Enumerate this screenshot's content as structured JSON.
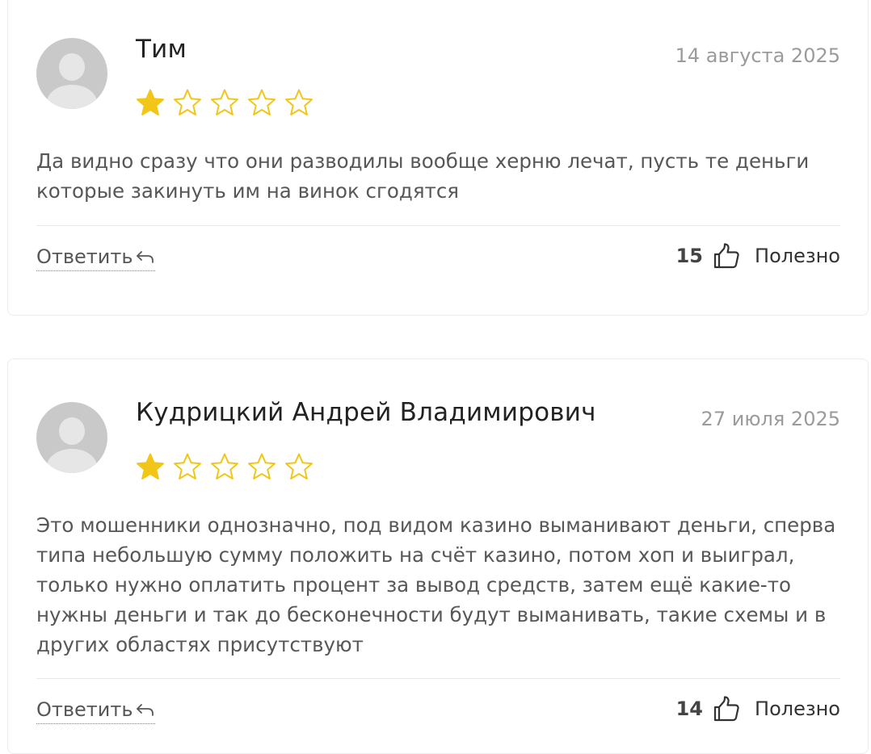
{
  "reviews": [
    {
      "author": "Тим",
      "date": "14 августа 2025",
      "rating": 1,
      "rating_max": 5,
      "text": "Да видно сразу что они разводилы вообще херню лечат, пусть те деньги которые закинуть им на винок сгодятся",
      "reply_label": "Ответить",
      "votes": "15",
      "helpful_label": "Полезно"
    },
    {
      "author": "Кудрицкий Андрей Владимирович",
      "date": "27 июля 2025",
      "rating": 1,
      "rating_max": 5,
      "text": "Это мошенники однозначно, под видом казино выманивают деньги, сперва типа небольшую сумму положить на счёт казино, потом хоп и выиграл, только нужно оплатить процент за вывод средств, затем ещё какие-то нужны деньги и так до бесконечности будут выманивать, такие схемы и в других областях присутствуют",
      "reply_label": "Ответить",
      "votes": "14",
      "helpful_label": "Полезно"
    }
  ],
  "icons": {
    "avatar": "user-avatar-placeholder",
    "star_filled": "star-filled-icon",
    "star_empty": "star-outline-icon",
    "reply": "reply-arrow-icon",
    "thumb": "thumbs-up-icon"
  },
  "colors": {
    "star": "#f2c618",
    "text": "#575757",
    "date": "#9b9b9b",
    "avatar_bg": "#c9c9c9"
  }
}
